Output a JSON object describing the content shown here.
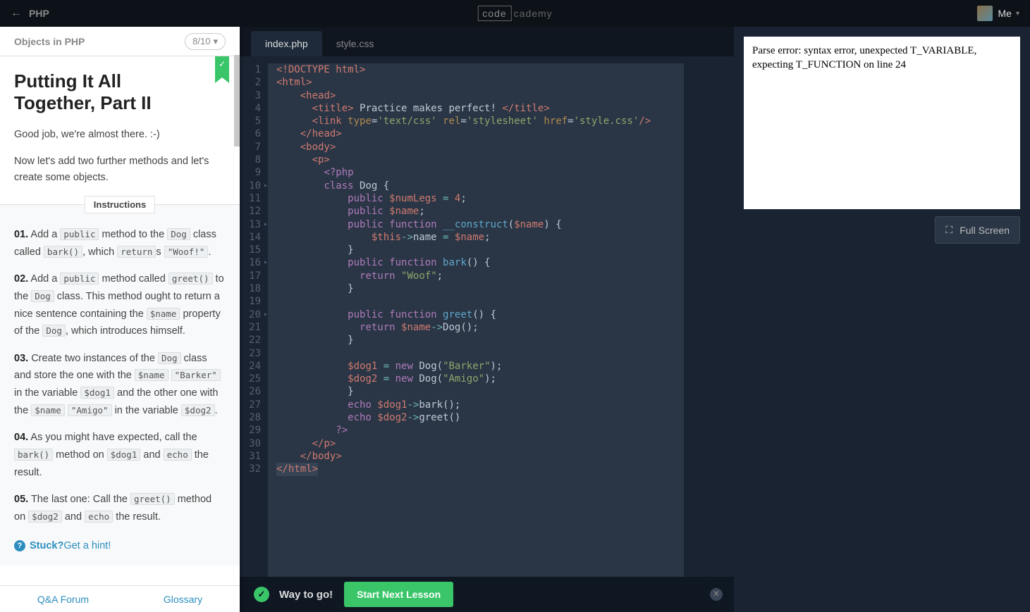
{
  "topbar": {
    "back_label": "PHP",
    "logo_box": "code",
    "logo_text": "cademy",
    "user_label": "Me"
  },
  "left_panel": {
    "header_title": "Objects in PHP",
    "progress": "8/10",
    "lesson_title": "Putting It All Together, Part II",
    "intro_1": "Good job, we're almost there. :-)",
    "intro_2": "Now let's add two further methods and let's create some objects.",
    "instructions_label": "Instructions",
    "instructions": [
      {
        "num": "01.",
        "parts": [
          " Add a ",
          {
            "code": "public"
          },
          " method to the ",
          {
            "code": "Dog"
          },
          " class called ",
          {
            "code": "bark()"
          },
          ", which ",
          {
            "code": "return"
          },
          "s ",
          {
            "code": "\"Woof!\""
          },
          "."
        ]
      },
      {
        "num": "02.",
        "parts": [
          " Add a ",
          {
            "code": "public"
          },
          " method called ",
          {
            "code": "greet()"
          },
          " to the ",
          {
            "code": "Dog"
          },
          " class. This method ought to return a nice sentence containing the ",
          {
            "code": "$name"
          },
          " property of the ",
          {
            "code": "Dog"
          },
          ", which introduces himself."
        ]
      },
      {
        "num": "03.",
        "parts": [
          " Create two instances of the ",
          {
            "code": "Dog"
          },
          " class and store the one with the ",
          {
            "code": "$name"
          },
          " ",
          {
            "code": "\"Barker\""
          },
          " in the variable ",
          {
            "code": "$dog1"
          },
          " and the other one with the ",
          {
            "code": "$name"
          },
          " ",
          {
            "code": "\"Amigo\""
          },
          " in the variable ",
          {
            "code": "$dog2"
          },
          "."
        ]
      },
      {
        "num": "04.",
        "parts": [
          " As you might have expected, call the ",
          {
            "code": "bark()"
          },
          " method on ",
          {
            "code": "$dog1"
          },
          " and ",
          {
            "code": "echo"
          },
          " the result."
        ]
      },
      {
        "num": "05.",
        "parts": [
          " The last one: Call the ",
          {
            "code": "greet()"
          },
          " method on ",
          {
            "code": "$dog2"
          },
          " and ",
          {
            "code": "echo"
          },
          " the result."
        ]
      }
    ],
    "hint_bold": "Stuck?",
    "hint_text": " Get a hint!",
    "footer_qa": "Q&A Forum",
    "footer_glossary": "Glossary"
  },
  "editor": {
    "tabs": [
      {
        "label": "index.php",
        "active": true
      },
      {
        "label": "style.css",
        "active": false
      }
    ],
    "lines": [
      {
        "n": 1,
        "html": "<span class='c-tag'>&lt;!DOCTYPE html&gt;</span>"
      },
      {
        "n": 2,
        "html": "<span class='c-tag'>&lt;html&gt;</span>"
      },
      {
        "n": 3,
        "html": "    <span class='c-tag'>&lt;head&gt;</span>"
      },
      {
        "n": 4,
        "html": "      <span class='c-tag'>&lt;title&gt;</span><span class='c-text'> Practice makes perfect! </span><span class='c-tag'>&lt;/title&gt;</span>"
      },
      {
        "n": 5,
        "html": "      <span class='c-tag'>&lt;link</span> <span class='c-attr'>type</span><span class='c-text'>=</span><span class='c-str'>'text/css'</span> <span class='c-attr'>rel</span><span class='c-text'>=</span><span class='c-str'>'stylesheet'</span> <span class='c-attr'>href</span><span class='c-text'>=</span><span class='c-str'>'style.css'</span><span class='c-tag'>/&gt;</span>"
      },
      {
        "n": 6,
        "html": "    <span class='c-tag'>&lt;/head&gt;</span>"
      },
      {
        "n": 7,
        "html": "    <span class='c-tag'>&lt;body&gt;</span>"
      },
      {
        "n": 8,
        "html": "      <span class='c-tag'>&lt;p&gt;</span>"
      },
      {
        "n": 9,
        "html": "        <span class='c-php'>&lt;?php</span>"
      },
      {
        "n": 10,
        "fold": true,
        "html": "        <span class='c-key'>class</span> <span class='c-text'>Dog {</span>"
      },
      {
        "n": 11,
        "html": "            <span class='c-key'>public</span> <span class='c-var'>$numLegs</span> <span class='c-op'>=</span> <span class='c-num'>4</span><span class='c-text'>;</span>"
      },
      {
        "n": 12,
        "html": "            <span class='c-key'>public</span> <span class='c-var'>$name</span><span class='c-text'>;</span>"
      },
      {
        "n": 13,
        "fold": true,
        "html": "            <span class='c-key'>public</span> <span class='c-key'>function</span> <span class='c-func'>__construct</span><span class='c-text'>(</span><span class='c-var'>$name</span><span class='c-text'>) {</span>"
      },
      {
        "n": 14,
        "html": "                <span class='c-var'>$this</span><span class='c-op'>-&gt;</span><span class='c-text'>name </span><span class='c-op'>=</span> <span class='c-var'>$name</span><span class='c-text'>;</span>"
      },
      {
        "n": 15,
        "html": "            <span class='c-text'>}</span>"
      },
      {
        "n": 16,
        "fold": true,
        "html": "            <span class='c-key'>public</span> <span class='c-key'>function</span> <span class='c-func'>bark</span><span class='c-text'>() {</span>"
      },
      {
        "n": 17,
        "html": "              <span class='c-key'>return</span> <span class='c-str'>\"Woof\"</span><span class='c-text'>;</span>"
      },
      {
        "n": 18,
        "html": "            <span class='c-text'>}</span>"
      },
      {
        "n": 19,
        "html": ""
      },
      {
        "n": 20,
        "fold": true,
        "html": "            <span class='c-key'>public</span> <span class='c-key'>function</span> <span class='c-func'>greet</span><span class='c-text'>() {</span>"
      },
      {
        "n": 21,
        "html": "              <span class='c-key'>return</span> <span class='c-var'>$name</span><span class='c-op'>-&gt;</span><span class='c-text'>Dog();</span>"
      },
      {
        "n": 22,
        "html": "            <span class='c-text'>}</span>"
      },
      {
        "n": 23,
        "html": ""
      },
      {
        "n": 24,
        "html": "            <span class='c-var'>$dog1</span> <span class='c-op'>=</span> <span class='c-key'>new</span> <span class='c-text'>Dog(</span><span class='c-str'>\"Barker\"</span><span class='c-text'>);</span>"
      },
      {
        "n": 25,
        "html": "            <span class='c-var'>$dog2</span> <span class='c-op'>=</span> <span class='c-key'>new</span> <span class='c-text'>Dog(</span><span class='c-str'>\"Amigo\"</span><span class='c-text'>);</span>"
      },
      {
        "n": 26,
        "html": "            <span class='c-text'>}</span>"
      },
      {
        "n": 27,
        "html": "            <span class='c-key'>echo</span> <span class='c-var'>$dog1</span><span class='c-op'>-&gt;</span><span class='c-text'>bark();</span>"
      },
      {
        "n": 28,
        "html": "            <span class='c-key'>echo</span> <span class='c-var'>$dog2</span><span class='c-op'>-&gt;</span><span class='c-text'>greet()</span>"
      },
      {
        "n": 29,
        "html": "          <span class='c-php'>?&gt;</span>"
      },
      {
        "n": 30,
        "html": "      <span class='c-tag'>&lt;/p&gt;</span>"
      },
      {
        "n": 31,
        "html": "    <span class='c-tag'>&lt;/body&gt;</span>"
      },
      {
        "n": 32,
        "html": "<span class='c-tag hl-line'>&lt;/html&gt;</span>"
      }
    ]
  },
  "status": {
    "message": "Way to go!",
    "button": "Start Next Lesson"
  },
  "output": {
    "text": "Parse error: syntax error, unexpected T_VARIABLE, expecting T_FUNCTION on line 24",
    "fullscreen_label": "Full Screen"
  }
}
